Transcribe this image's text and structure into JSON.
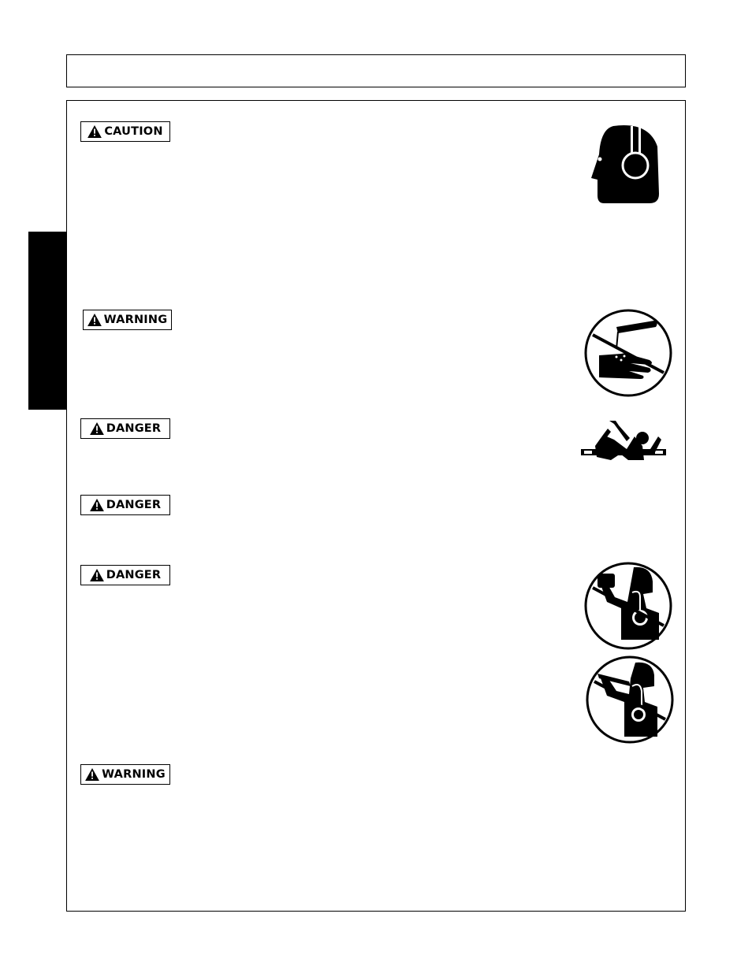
{
  "page": {
    "header_title": "",
    "side_tab_label": ""
  },
  "colors": {
    "ink": "#000000",
    "paper": "#ffffff"
  },
  "sections": [
    {
      "signal_word": "CAUTION",
      "icon": "hearing-protection-icon",
      "body_text": ""
    },
    {
      "signal_word": "WARNING",
      "icon": "no-chemical-on-hand-icon",
      "body_text": ""
    },
    {
      "signal_word": "DANGER",
      "icon": "entanglement-driveline-icon",
      "body_text": ""
    },
    {
      "signal_word": "DANGER",
      "icon": "",
      "body_text": ""
    },
    {
      "signal_word": "DANGER",
      "icons": [
        "no-drugs-icon",
        "no-alcohol-icon"
      ],
      "body_text": ""
    },
    {
      "signal_word": "WARNING",
      "icon": "",
      "body_text": ""
    }
  ]
}
